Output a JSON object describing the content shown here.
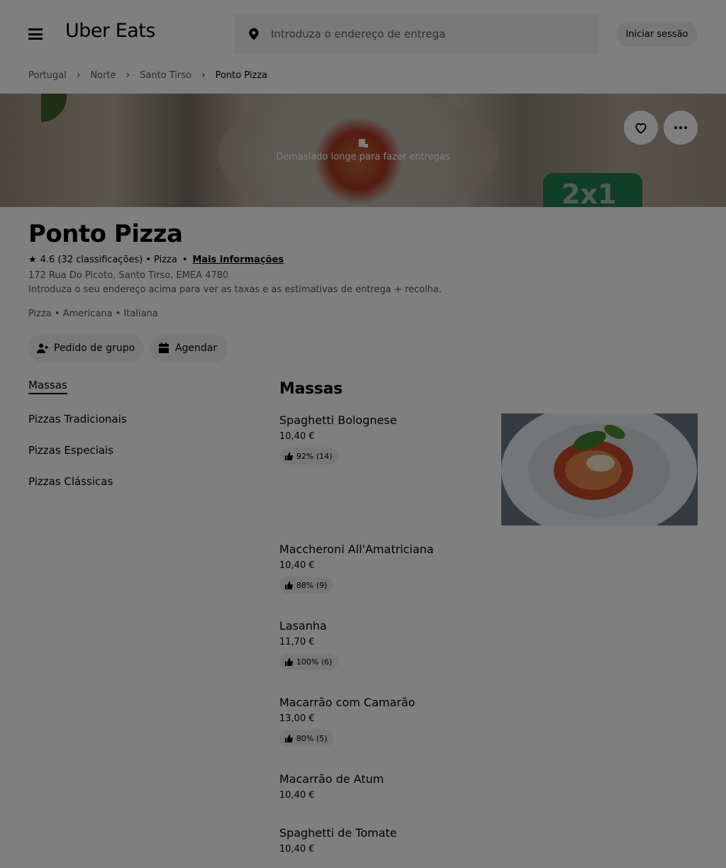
{
  "header": {
    "brand": "Uber Eats",
    "address_placeholder": "Introduza o endereço de entrega",
    "signin_label": "Iniciar sessão"
  },
  "breadcrumb": [
    "Portugal",
    "Norte",
    "Santo Tirso",
    "Ponto Pizza"
  ],
  "hero": {
    "message": "Demasiado longe para fazer entregas",
    "badge_text": "2x1"
  },
  "store": {
    "name": "Ponto Pizza",
    "rating": "4.6",
    "rating_count": "(32 classificações)",
    "category": "Pizza",
    "more_info_label": "Mais informações",
    "address": "172 Rua Do Picoto, Santo Tirso, EMEA 4780",
    "hint": "Introduza o seu endereço acima para ver as taxas e as estimativas de entrega + recolha.",
    "cuisines": "Pizza • Americana • Italiana"
  },
  "actions": {
    "group_order_label": "Pedido de grupo",
    "schedule_label": "Agendar"
  },
  "menu_nav": [
    "Massas",
    "Pizzas Tradicionais",
    "Pizzas Especiais",
    "Pizzas Clássicas"
  ],
  "section": {
    "title": "Massas",
    "items": [
      {
        "name": "Spaghetti Bolognese",
        "price": "10,40 €",
        "rating": "92% (14)"
      },
      {
        "name": "Maccheroni All'Amatriciana",
        "price": "10,40 €",
        "rating": "88% (9)"
      },
      {
        "name": "Lasanha",
        "price": "11,70 €",
        "rating": "100% (6)"
      },
      {
        "name": "Macarrão com Camarão",
        "price": "13,00 €",
        "rating": "80% (5)"
      },
      {
        "name": "Macarrão de Atum",
        "price": "10,40 €",
        "rating": ""
      },
      {
        "name": "Spaghetti de Tomate",
        "price": "10,40 €",
        "rating": ""
      }
    ]
  },
  "icons": {
    "menu": "hamburger-icon",
    "location": "location-pin-icon",
    "favorite": "heart-icon",
    "more": "ellipsis-icon",
    "chevron": "chevron-right-icon",
    "star": "star-icon",
    "group": "add-person-icon",
    "calendar": "calendar-icon",
    "thumb": "thumbs-up-icon",
    "store_closed": "store-closed-icon"
  }
}
